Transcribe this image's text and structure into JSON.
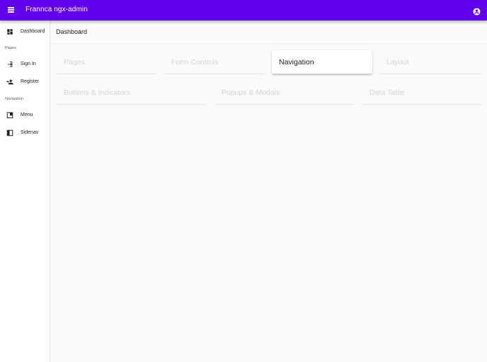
{
  "header": {
    "title": "Frannca ngx-admin",
    "menu_icon": "menu-icon",
    "account_icon": "account-circle-icon",
    "background": "#6200ee"
  },
  "sidebar": {
    "items": [
      {
        "label": "Dashboard",
        "icon": "dashboard-icon"
      },
      {
        "label": "Sign In",
        "icon": "login-icon"
      },
      {
        "label": "Register",
        "icon": "person-add-icon"
      },
      {
        "label": "Menu",
        "icon": "menu-panel-icon"
      },
      {
        "label": "Sidenav",
        "icon": "sidenav-icon"
      }
    ],
    "sections": [
      {
        "label": "Pages"
      },
      {
        "label": "Navigation"
      }
    ]
  },
  "main": {
    "title": "Dashboard",
    "cards": [
      {
        "label": "Pages",
        "active": false
      },
      {
        "label": "Form Controls",
        "active": false
      },
      {
        "label": "Navigation",
        "active": true
      },
      {
        "label": "Layout",
        "active": false
      },
      {
        "label": "Buttons & Indicators",
        "active": false
      },
      {
        "label": "Popups & Modals",
        "active": false
      },
      {
        "label": "Data Table",
        "active": false
      }
    ]
  }
}
